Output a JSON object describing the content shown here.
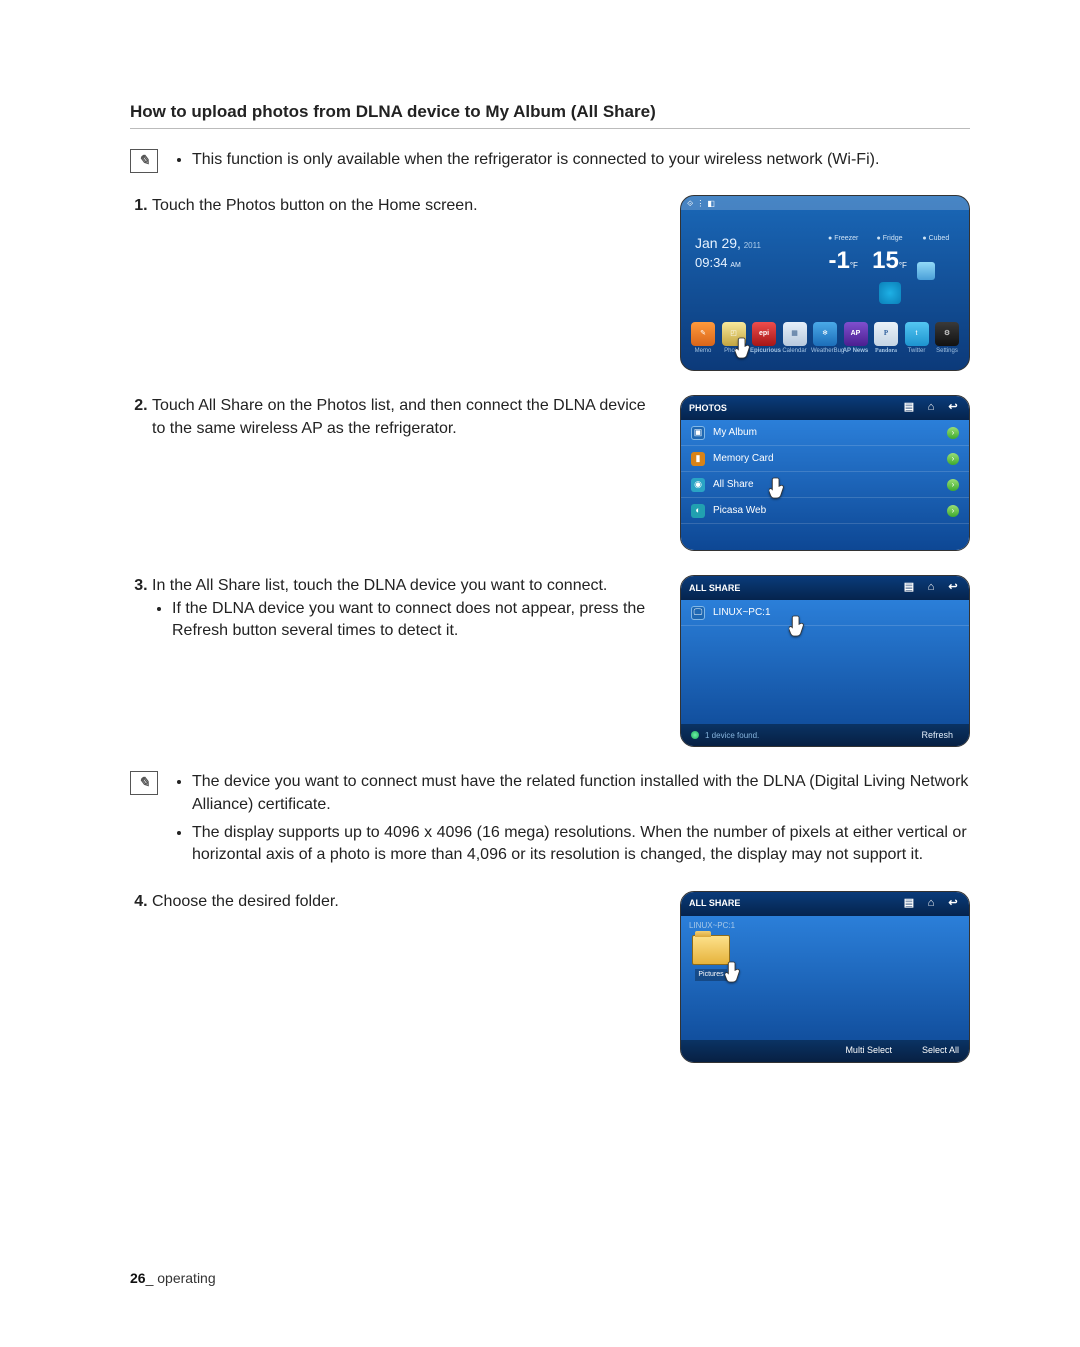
{
  "section_title": "How to upload photos from DLNA device to My Album (All Share)",
  "note1": "This function is only available when the refrigerator is connected to your wireless network (Wi-Fi).",
  "steps": {
    "s1": "Touch the Photos button on the Home screen.",
    "s2": "Touch All Share on the Photos list, and then connect the DLNA device to the same wireless AP as the refrigerator.",
    "s3": "In the All Share list, touch the DLNA device you want to connect.",
    "s3_sub": "If the DLNA device you want to connect does not appear, press the Refresh button several times to detect it.",
    "s4": "Choose the desired folder."
  },
  "note2a": "The device you want to connect must have the related function installed with the DLNA (Digital Living Network Alliance) certificate.",
  "note2b": "The display supports up to 4096 x 4096 (16 mega) resolutions. When the number of pixels at either vertical or horizontal axis of a photo is more than 4,096 or its resolution is changed, the display may not support it.",
  "home": {
    "date_line": "Jan 29,",
    "year": "2011",
    "time": "09:34",
    "ampm": "AM",
    "freezer_label": "Freezer",
    "fridge_label": "Fridge",
    "cubed_label": "Cubed",
    "freezer_val": "-1",
    "fridge_val": "15",
    "unit": "°F",
    "apps": {
      "memo": "Memo",
      "photos": "Photos",
      "epicurious": "Epicurious",
      "calendar": "Calendar",
      "weather": "WeatherBug",
      "ap": "AP News",
      "pandora": "Pandora",
      "twitter": "Twitter",
      "settings": "Settings"
    }
  },
  "photos_panel": {
    "title": "PHOTOS",
    "items": {
      "my_album": "My Album",
      "memory_card": "Memory Card",
      "all_share": "All Share",
      "picasa": "Picasa Web"
    }
  },
  "allshare_panel": {
    "title": "ALL SHARE",
    "device": "LINUX~PC:1",
    "status": "1 device found.",
    "refresh": "Refresh"
  },
  "folder_panel": {
    "title": "ALL SHARE",
    "breadcrumb": "LINUX~PC:1",
    "folder": "Pictures",
    "multi_select": "Multi Select",
    "select_all": "Select All"
  },
  "footer": {
    "page": "26",
    "section": "_ operating"
  }
}
